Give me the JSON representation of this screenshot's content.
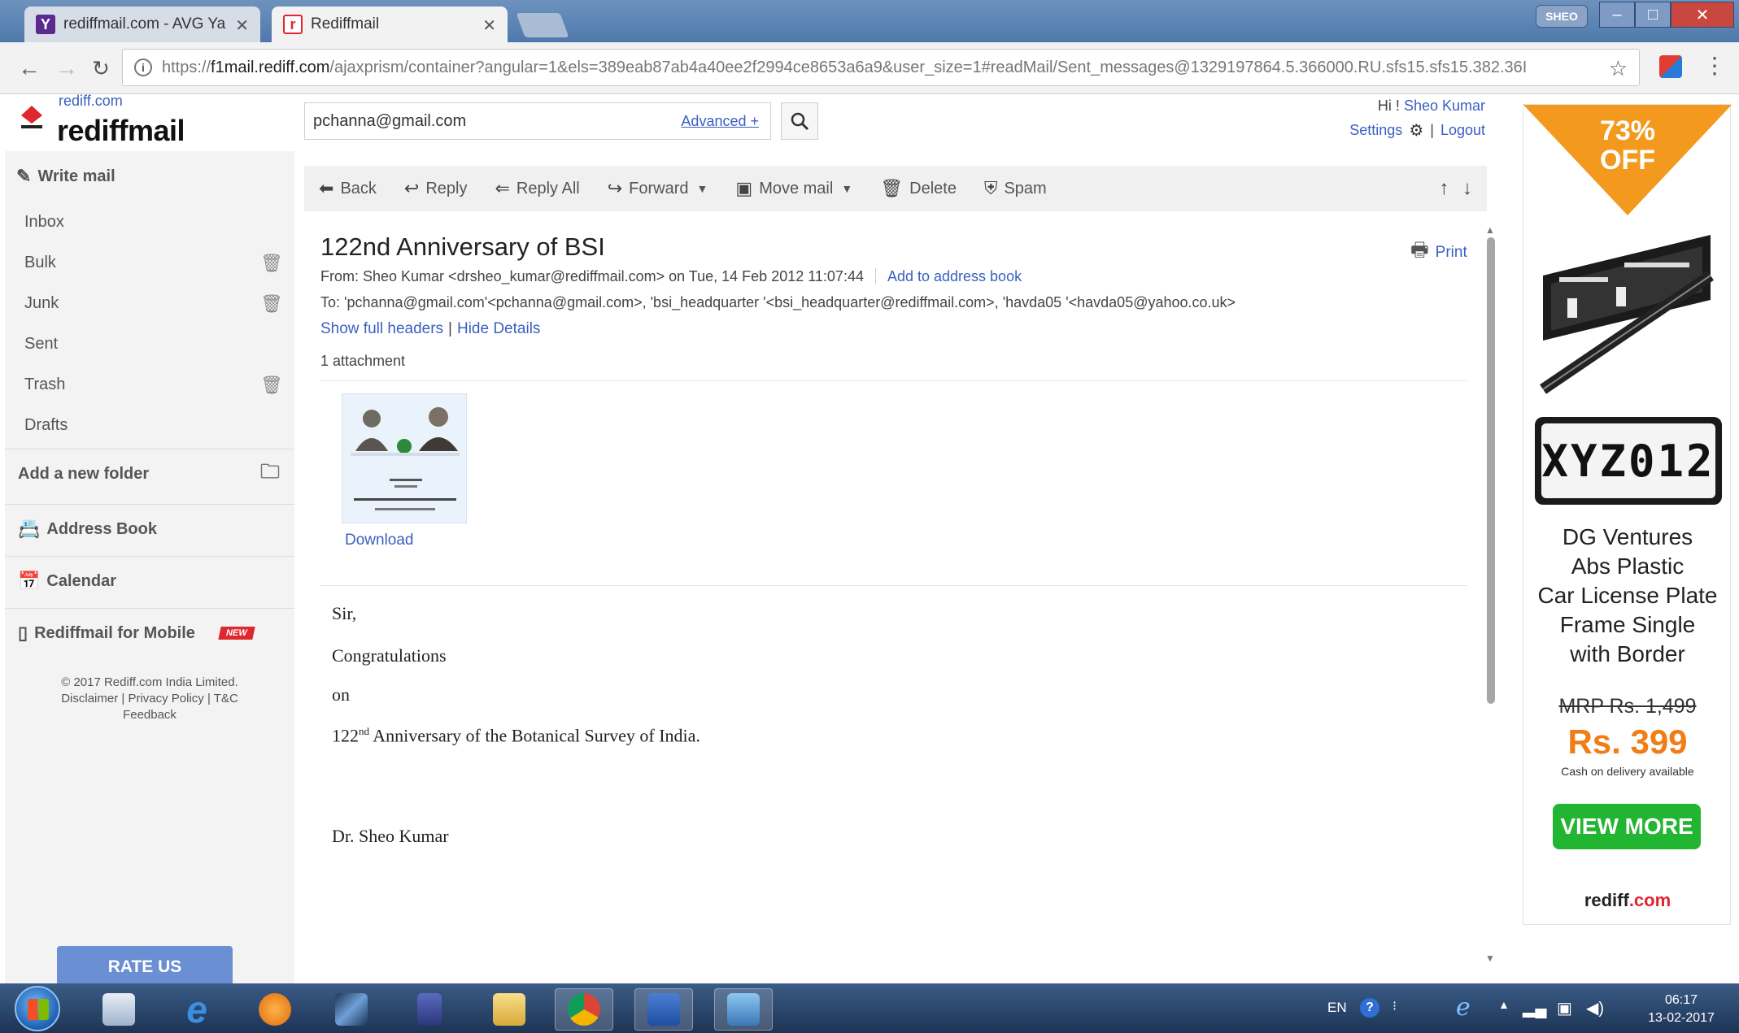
{
  "browser": {
    "tabs": [
      {
        "title": "rediffmail.com - AVG Ya",
        "active": false
      },
      {
        "title": "Rediffmail",
        "active": true
      }
    ],
    "url_scheme": "https://",
    "url_host": "f1mail.rediff.com",
    "url_path": "/ajaxprism/container?angular=1&els=389eab87ab4a40ee2f2994ce8653a6a9&user_size=1#readMail/Sent_messages@1329197864.5.366000.RU.sfs15.sfs15.382.36I",
    "badge": "SHEO"
  },
  "header": {
    "logo_small": "rediff.com",
    "logo": "rediffmail",
    "search_value": "pchanna@gmail.com",
    "search_advanced": "Advanced +",
    "greeting_prefix": "Hi ! ",
    "user_name": "Sheo Kumar",
    "settings": "Settings",
    "logout": "Logout"
  },
  "sidebar": {
    "write_mail": "Write mail",
    "folders": [
      {
        "label": "Inbox",
        "trash": false
      },
      {
        "label": "Bulk",
        "trash": true
      },
      {
        "label": "Junk",
        "trash": true
      },
      {
        "label": "Sent",
        "trash": false
      },
      {
        "label": "Trash",
        "trash": true
      },
      {
        "label": "Drafts",
        "trash": false
      }
    ],
    "add_folder": "Add a new folder",
    "address_book": "Address Book",
    "calendar": "Calendar",
    "mobile": "Rediffmail for Mobile",
    "new_flag": "NEW",
    "copyright": "© 2017 Rediff.com India Limited.",
    "links": "Disclaimer | Privacy Policy | T&C",
    "feedback": "Feedback",
    "rate_us": "RATE US"
  },
  "toolbar": {
    "back": "Back",
    "reply": "Reply",
    "reply_all": "Reply All",
    "forward": "Forward",
    "move_mail": "Move mail",
    "delete": "Delete",
    "spam": "Spam"
  },
  "mail": {
    "subject": "122nd Anniversary of BSI",
    "print": "Print",
    "from": "From: Sheo Kumar <drsheo_kumar@rediffmail.com> on Tue, 14 Feb 2012 11:07:44",
    "add_to_address_book": "Add to address book",
    "to": "To: 'pchanna@gmail.com'<pchanna@gmail.com>, 'bsi_headquarter '<bsi_headquarter@rediffmail.com>, 'havda05 '<havda05@yahoo.co.uk>",
    "show_full_headers": "Show full headers",
    "hide_details": "Hide Details",
    "attachment_count": "1 attachment",
    "download": "Download",
    "body": {
      "salutation": "Sir,",
      "line1": "Congratulations",
      "line2": "on",
      "anniv_num": "122",
      "anniv_sup": "nd",
      "anniv_rest": " Anniversary of the Botanical Survey of India.",
      "signature": "Dr. Sheo Kumar"
    }
  },
  "ad": {
    "discount": "73%",
    "off": "OFF",
    "plate_text": "XYZ012",
    "title_lines": [
      "DG Ventures",
      "Abs Plastic",
      "Car License Plate",
      "Frame Single",
      "with Border"
    ],
    "mrp": "MRP Rs. 1,499",
    "price": "Rs. 399",
    "cod": "Cash on delivery available",
    "cta": "VIEW MORE",
    "brand_a": "rediff",
    "brand_b": ".com"
  },
  "taskbar": {
    "lang": "EN",
    "time": "06:17",
    "date": "13-02-2017"
  },
  "colors": {
    "link": "#3a5fc0",
    "accent_orange": "#f39a1e",
    "cta_green": "#22b531",
    "brand_red": "#e0262f"
  }
}
